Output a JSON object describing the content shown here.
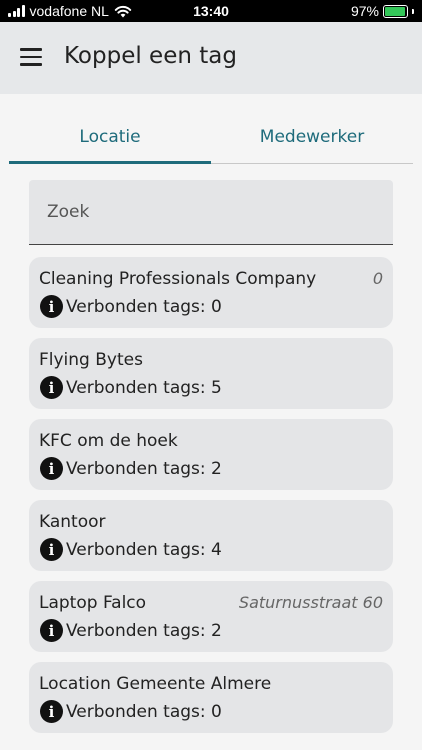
{
  "status_bar": {
    "carrier": "vodafone NL",
    "time": "13:40",
    "battery": "97%",
    "battery_level": 0.97
  },
  "app_bar": {
    "title": "Koppel een tag",
    "menu_icon": "menu-icon"
  },
  "tabs": [
    {
      "label": "Locatie",
      "active": true
    },
    {
      "label": "Medewerker",
      "active": false
    }
  ],
  "search": {
    "placeholder": "Zoek",
    "value": ""
  },
  "locations": [
    {
      "name": "Cleaning Professionals Company",
      "extra": "0",
      "tags": "Verbonden tags: 0"
    },
    {
      "name": "Flying Bytes",
      "extra": "",
      "tags": "Verbonden tags: 5"
    },
    {
      "name": "KFC om de hoek",
      "extra": "",
      "tags": "Verbonden tags: 2"
    },
    {
      "name": "Kantoor",
      "extra": "",
      "tags": "Verbonden tags: 4"
    },
    {
      "name": "Laptop Falco",
      "extra": "Saturnusstraat 60",
      "tags": "Verbonden tags: 2"
    },
    {
      "name": "Location Gemeente Almere",
      "extra": "",
      "tags": "Verbonden tags: 0"
    }
  ],
  "icons": {
    "info": "info-icon"
  }
}
